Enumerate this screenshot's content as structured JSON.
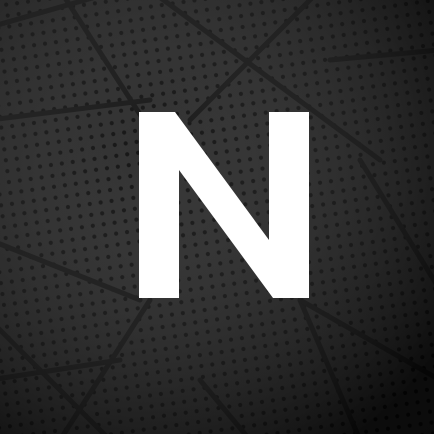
{
  "logo": {
    "lettering": "N",
    "color": "#ffffff"
  },
  "background": {
    "base_color": "#151515",
    "dot_color": "#050505",
    "seam_color": "#0a0a0a",
    "pattern": "perforated-metal-triangles"
  }
}
